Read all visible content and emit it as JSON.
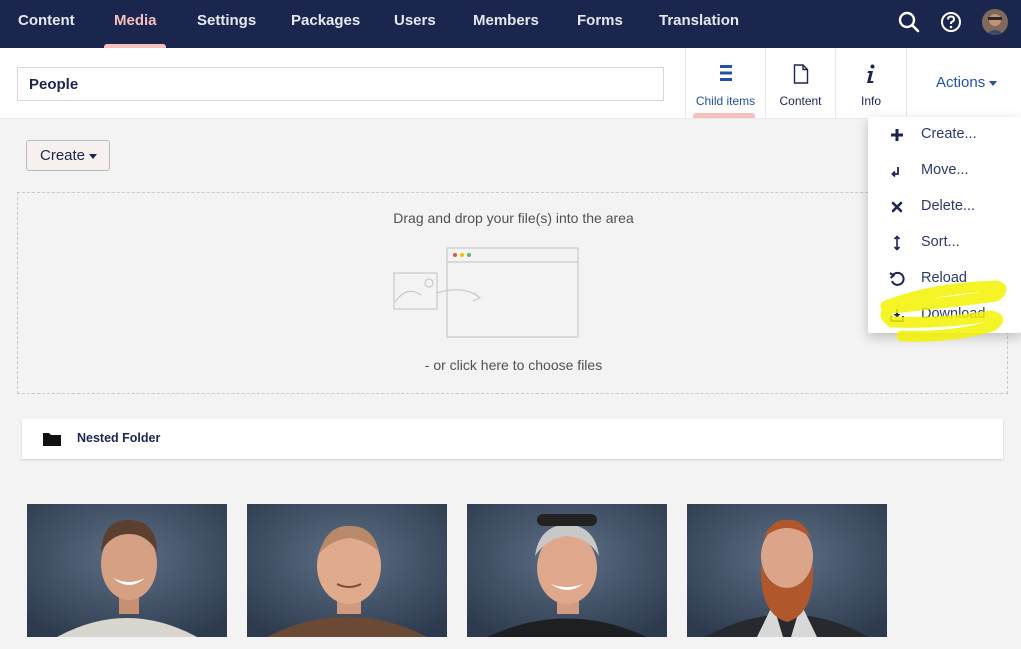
{
  "topnav": {
    "items": [
      "Content",
      "Media",
      "Settings",
      "Packages",
      "Users",
      "Members",
      "Forms",
      "Translation"
    ],
    "active": "Media",
    "icons": [
      "search-icon",
      "help-icon"
    ]
  },
  "header": {
    "name_value": "People",
    "tabs": [
      {
        "label": "Child items",
        "icon": "list-icon",
        "active": true
      },
      {
        "label": "Content",
        "icon": "document-icon",
        "active": false
      },
      {
        "label": "Info",
        "icon": "info-icon",
        "active": false
      }
    ],
    "actions_label": "Actions"
  },
  "toolbar": {
    "create_label": "Create"
  },
  "dropzone": {
    "title": "Drag and drop your file(s) into the area",
    "link": "- or click here to choose files"
  },
  "folders": [
    {
      "name": "Nested Folder"
    }
  ],
  "actions_menu": [
    {
      "label": "Create...",
      "icon": "plus-icon"
    },
    {
      "label": "Move...",
      "icon": "move-icon"
    },
    {
      "label": "Delete...",
      "icon": "delete-icon"
    },
    {
      "label": "Sort...",
      "icon": "sort-icon"
    },
    {
      "label": "Reload",
      "icon": "reload-icon"
    },
    {
      "label": "Download",
      "icon": "download-icon"
    }
  ],
  "photos": [
    "photo-1",
    "photo-2",
    "photo-3",
    "photo-4"
  ],
  "colors": {
    "nav_bg": "#1b264f",
    "accent_pink": "#f5c1bc",
    "link_blue": "#2152a3",
    "highlight": "#f2f200"
  }
}
